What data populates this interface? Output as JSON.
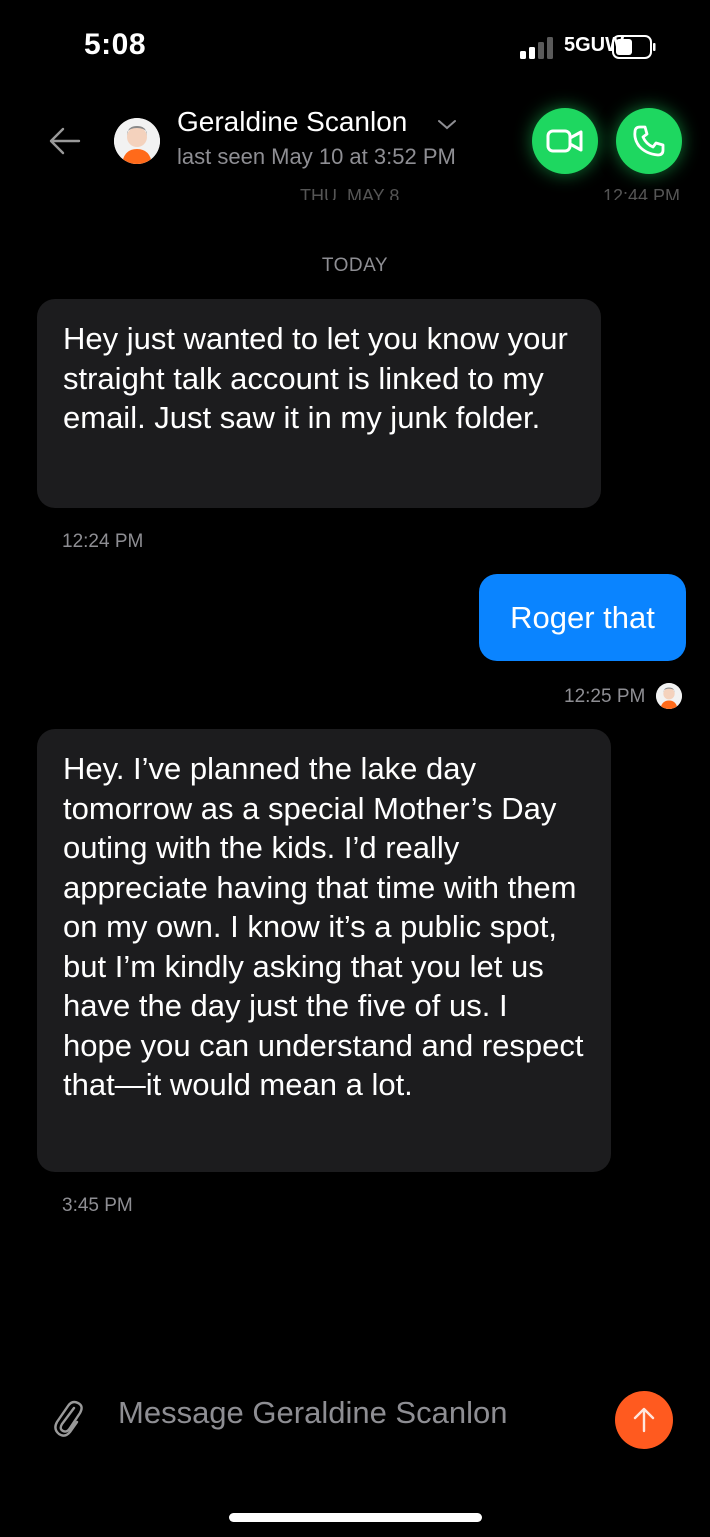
{
  "status_bar": {
    "time": "5:08",
    "network": "5GUW"
  },
  "header": {
    "contact_name": "Geraldine Scanlon",
    "last_seen": "last seen May 10 at 3:52 PM",
    "clipped_date": "THU, MAY 8",
    "clipped_time": "12:44 PM"
  },
  "chat": {
    "day_separator": "TODAY",
    "messages": [
      {
        "direction": "incoming",
        "text": "Hey just wanted to let you know your straight talk account is linked to my email. Just saw it in my junk folder.",
        "time": "12:24 PM"
      },
      {
        "direction": "outgoing",
        "text": "Roger that",
        "time": "12:25 PM"
      },
      {
        "direction": "incoming",
        "text": "Hey. I’ve planned the lake day tomorrow as a special Mother’s Day outing with the kids. I’d really appreciate having that time with them on my own. I know it’s a public spot, but I’m kindly asking that you let us have the day just the five of us. I hope you can understand and respect that—it would mean a lot.",
        "time": "3:45 PM"
      }
    ]
  },
  "composer": {
    "placeholder": "Message Geraldine Scanlon",
    "value": ""
  },
  "colors": {
    "incoming_bubble": "#1c1c1e",
    "outgoing_bubble": "#0a84ff",
    "call_green": "#1ed760",
    "send_orange": "#ff5a1f"
  },
  "icons": [
    "back-arrow-icon",
    "chevron-down-icon",
    "video-call-icon",
    "phone-call-icon",
    "paperclip-icon",
    "send-arrow-icon"
  ]
}
